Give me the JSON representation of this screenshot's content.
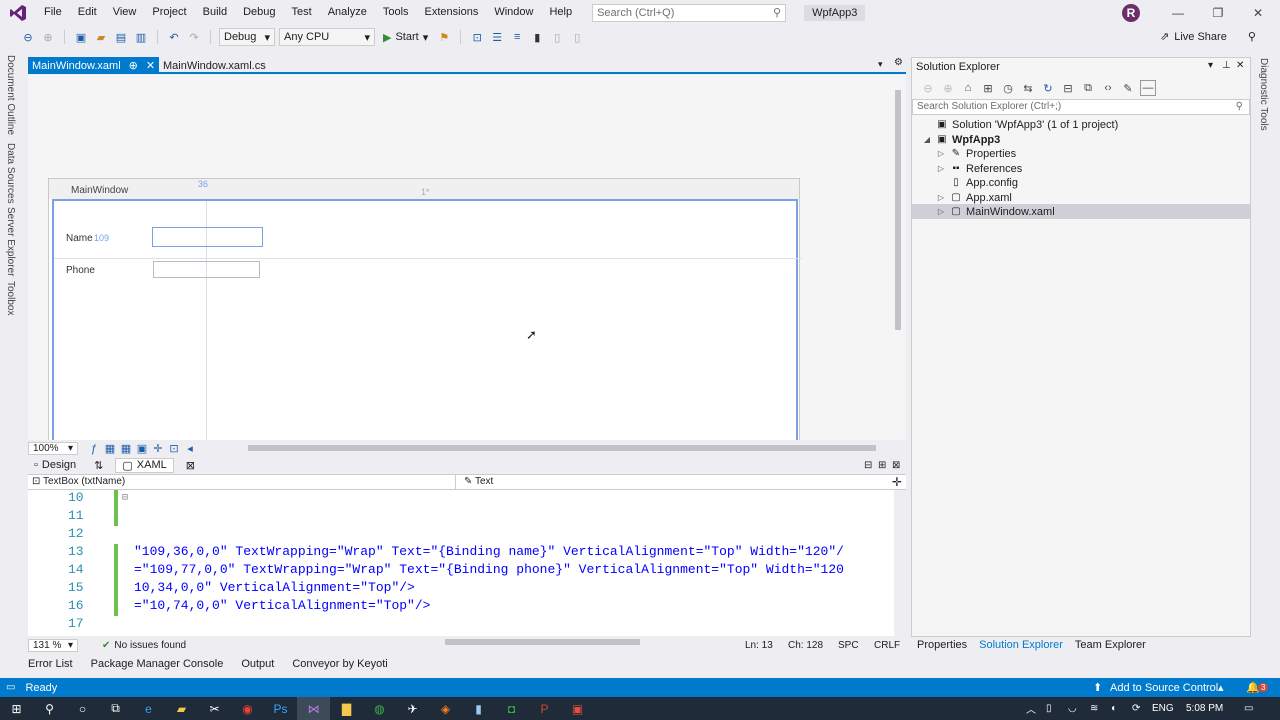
{
  "menu": {
    "items": [
      "File",
      "Edit",
      "View",
      "Project",
      "Build",
      "Debug",
      "Test",
      "Analyze",
      "Tools",
      "Extensions",
      "Window",
      "Help"
    ],
    "search_placeholder": "Search (Ctrl+Q)",
    "app_badge": "WpfApp3",
    "avatar_initial": "R"
  },
  "toolbar": {
    "config": "Debug",
    "platform": "Any CPU",
    "start_label": "Start",
    "live_share_label": "Live Share"
  },
  "left_tabs": [
    "Document Outline",
    "Data Sources",
    "Server Explorer",
    "Toolbox"
  ],
  "right_tab": "Diagnostic Tools",
  "doc_tabs": {
    "active": "MainWindow.xaml",
    "pin": "⊕",
    "close": "✕",
    "second": "MainWindow.xaml.cs"
  },
  "designer": {
    "window_title": "MainWindow",
    "margin_top": "36",
    "column_marker": "1*",
    "name_label": "Name",
    "name_margin": "109",
    "phone_label": "Phone",
    "zoom": "100%"
  },
  "split_tabs": {
    "design": "Design",
    "swap": "⇅",
    "xaml": "XAML"
  },
  "editor_nav": {
    "left": "TextBox (txtName)",
    "right": "Text"
  },
  "code": {
    "line_numbers": [
      "10",
      "11",
      "12",
      "13",
      "14",
      "15",
      "16",
      "17"
    ],
    "lines": [
      "",
      "",
      "",
      "\"109,36,0,0\" TextWrapping=\"Wrap\" Text=\"{Binding name}\" VerticalAlignment=\"Top\" Width=\"120\"/",
      "=\"109,77,0,0\" TextWrapping=\"Wrap\" Text=\"{Binding phone}\" VerticalAlignment=\"Top\" Width=\"120",
      "10,34,0,0\" VerticalAlignment=\"Top\"/>",
      "=\"10,74,0,0\" VerticalAlignment=\"Top\"/>",
      ""
    ]
  },
  "editor_status": {
    "zoom": "131 %",
    "issues": "No issues found",
    "line": "Ln: 13",
    "col": "Ch: 128",
    "spc": "SPC",
    "eol": "CRLF"
  },
  "bottom_tabs": [
    "Error List",
    "Package Manager Console",
    "Output",
    "Conveyor by Keyoti"
  ],
  "solution_explorer": {
    "title": "Solution Explorer",
    "search_placeholder": "Search Solution Explorer (Ctrl+;)",
    "tree": [
      {
        "label": "Solution 'WpfApp3' (1 of 1 project)",
        "indent": 0,
        "caret": "",
        "icon": "solution-icon",
        "bold": false
      },
      {
        "label": "WpfApp3",
        "indent": 1,
        "caret": "◢",
        "icon": "project-icon",
        "bold": true
      },
      {
        "label": "Properties",
        "indent": 2,
        "caret": "▷",
        "icon": "wrench-icon",
        "bold": false
      },
      {
        "label": "References",
        "indent": 2,
        "caret": "▷",
        "icon": "references-icon",
        "bold": false
      },
      {
        "label": "App.config",
        "indent": 2,
        "caret": "",
        "icon": "config-file-icon",
        "bold": false
      },
      {
        "label": "App.xaml",
        "indent": 2,
        "caret": "▷",
        "icon": "xaml-file-icon",
        "bold": false
      },
      {
        "label": "MainWindow.xaml",
        "indent": 2,
        "caret": "▷",
        "icon": "xaml-file-icon",
        "bold": false,
        "selected": true
      }
    ],
    "tabs": [
      "Properties",
      "Solution Explorer",
      "Team Explorer"
    ]
  },
  "statusbar": {
    "ready": "Ready",
    "source_control": "Add to Source Control",
    "notifications": "3"
  },
  "taskbar": {
    "lang": "ENG",
    "time": "5:08 PM"
  },
  "colors": {
    "accent": "#007acc",
    "taskbar": "#1f2b38",
    "vs_purple": "#68217a"
  }
}
